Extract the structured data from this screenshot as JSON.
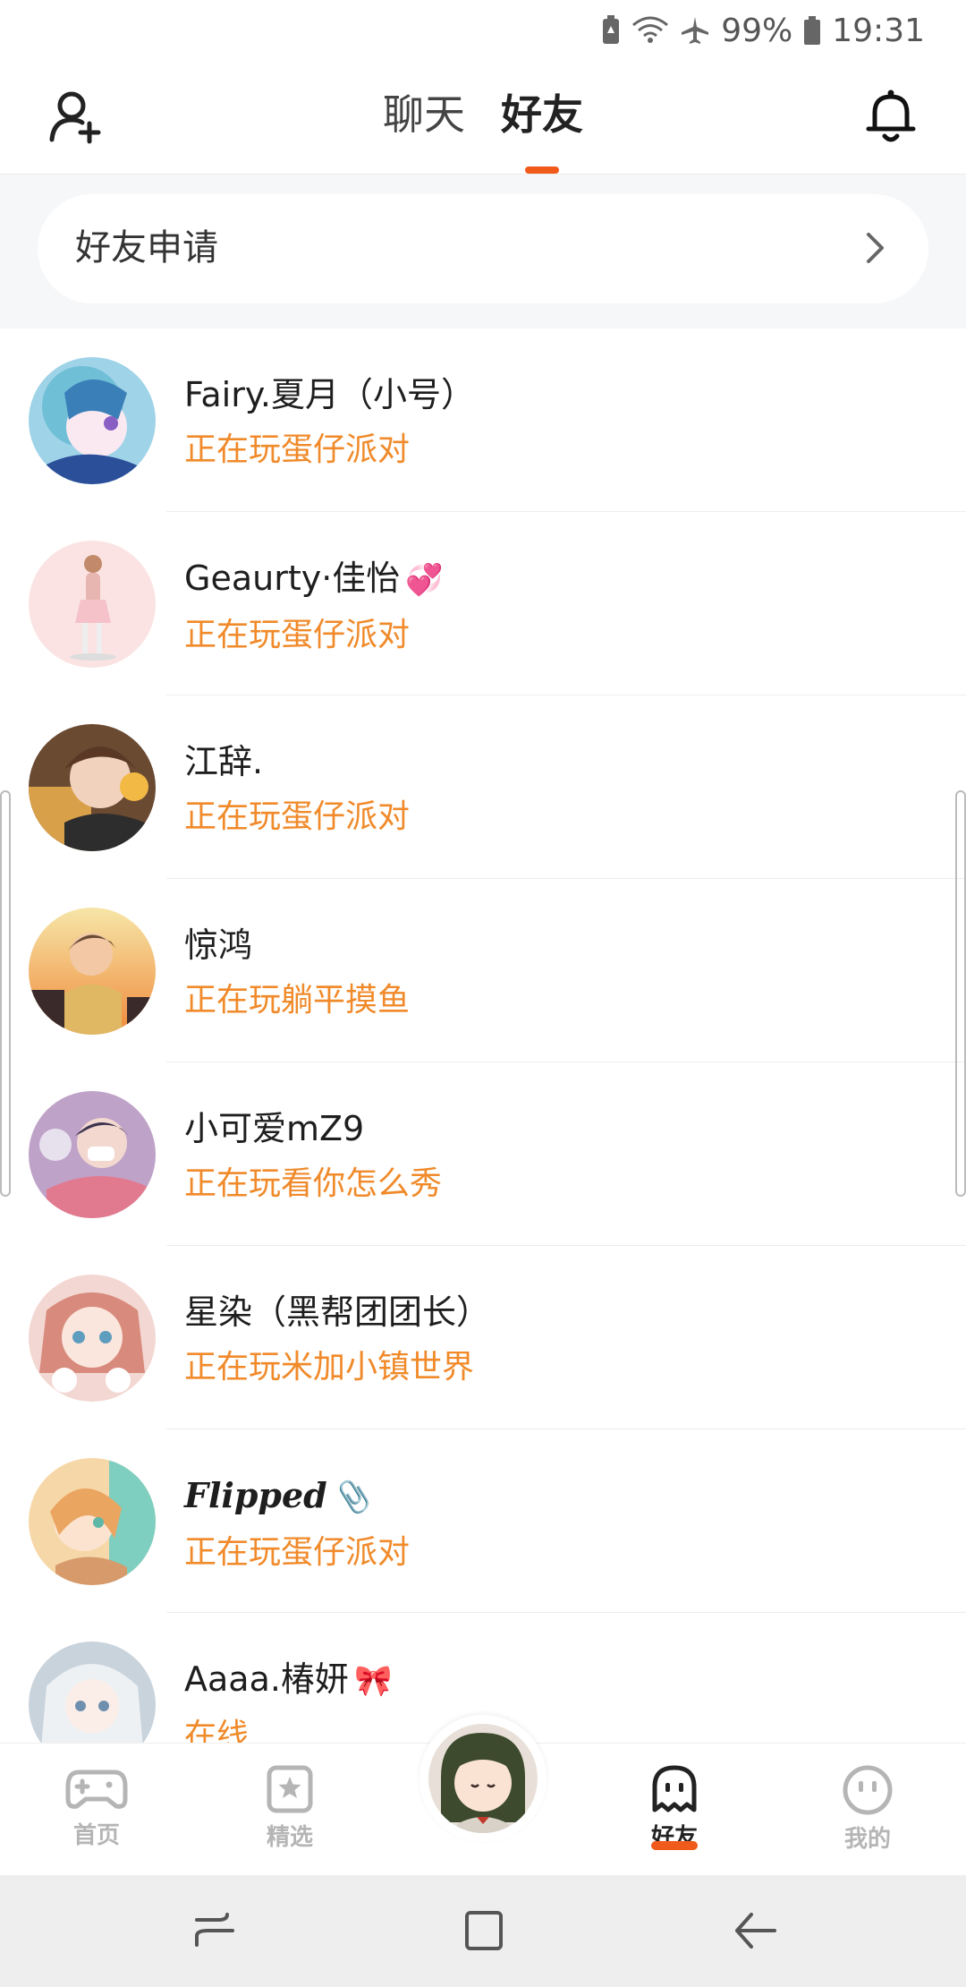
{
  "status_bar": {
    "battery_percent": "99%",
    "time": "19:31"
  },
  "top_nav": {
    "tabs": [
      {
        "label": "聊天"
      },
      {
        "label": "好友"
      }
    ],
    "active_tab": 1
  },
  "friend_request": {
    "label": "好友申请"
  },
  "friends": [
    {
      "name": "Fairy.夏月（小号）",
      "status": "正在玩蛋仔派对"
    },
    {
      "name": "Geaurty·佳怡",
      "emoji": "💞",
      "status": "正在玩蛋仔派对"
    },
    {
      "name": "江辞.",
      "status": "正在玩蛋仔派对"
    },
    {
      "name": "惊鸿",
      "status": "正在玩躺平摸鱼"
    },
    {
      "name": "小可爱mZ9",
      "status": "正在玩看你怎么秀"
    },
    {
      "name": "星染（黑帮团团长）",
      "status": "正在玩米加小镇世界"
    },
    {
      "name": "Flipped",
      "emoji": "📎",
      "status": "正在玩蛋仔派对"
    },
    {
      "name": "Aaaa.椿妍",
      "emoji": "🎀",
      "status": "在线"
    }
  ],
  "bottom_nav": {
    "items": [
      {
        "label": "首页",
        "icon": "gamepad-icon"
      },
      {
        "label": "精选",
        "icon": "star-badge-icon"
      },
      {
        "label": "好友",
        "icon": "ghost-icon"
      },
      {
        "label": "我的",
        "icon": "smiley-icon"
      }
    ],
    "active": "好友"
  },
  "colors": {
    "accent": "#f05a1a",
    "status_text": "#f08a2a",
    "band_bg": "#f6f7f9"
  }
}
